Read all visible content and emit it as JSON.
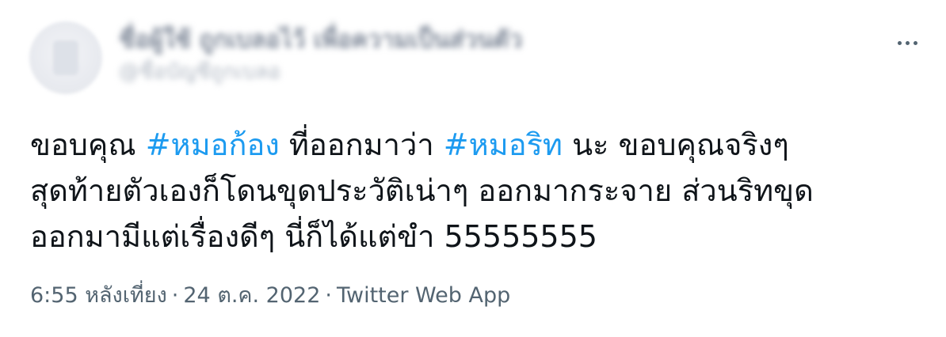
{
  "author": {
    "display_name": "ชื่อผู้ใช้ ถูกเบลอไว้ เพื่อความเป็นส่วนตัว",
    "handle": "@ชื่อบัญชีถูกเบลอ"
  },
  "tweet": {
    "line1": {
      "t1": "ขอบคุณ ",
      "h1": "#หมอก้อง",
      "t2": " ที่ออกมาว่า ",
      "h2": "#หมอริท",
      "t3": " นะ ขอบคุณจริงๆ"
    },
    "line2": "สุดท้ายตัวเองก็โดนขุดประวัติเน่าๆ ออกมากระจาย ส่วนริทขุด",
    "line3": "ออกมามีแต่เรื่องดีๆ นี่ก็ได้แต่ขำ 55555555"
  },
  "meta": {
    "time": "6:55 หลังเที่ยง",
    "separator": "·",
    "date": "24 ต.ค. 2022",
    "source": "Twitter Web App"
  },
  "icons": {
    "more": "more-horizontal-icon"
  },
  "colors": {
    "text": "#0f1419",
    "hashtag": "#1d9bf0",
    "secondary": "#536471",
    "background": "#ffffff"
  }
}
